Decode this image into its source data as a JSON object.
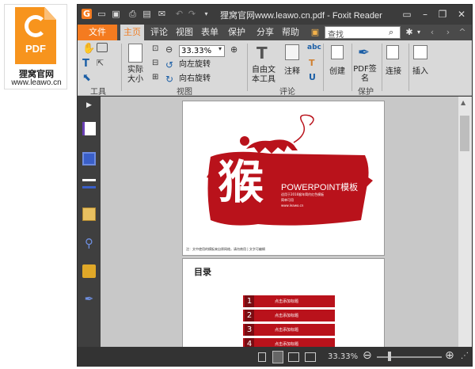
{
  "logo": {
    "badge": "PDF",
    "line1": "狸窝官网",
    "line2": "www.leawo.cn"
  },
  "window": {
    "title": "狸窝官网www.leawo.cn.pdf - Foxit Reader",
    "minimize": "–",
    "restore": "❐",
    "close": "✕"
  },
  "menus": [
    "文件",
    "主页",
    "评论",
    "视图",
    "表单",
    "保护",
    "分享",
    "帮助"
  ],
  "search": {
    "placeholder": "查找"
  },
  "ribbon": {
    "tools": {
      "group": "工具"
    },
    "view": {
      "group": "视图",
      "actual_size": "实际\n大小",
      "zoom": "33.33%",
      "rotate_left": "向左旋转",
      "rotate_right": "向右旋转"
    },
    "comment": {
      "group": "评论",
      "freetext": "自由文\n本工具",
      "note": "注释"
    },
    "protect": {
      "group": "保护",
      "create": "创建",
      "pdf_sign": "PDF签\n名",
      "link": "连接",
      "insert": "插入"
    }
  },
  "page1": {
    "big_char": "猴",
    "heading": "POWERPOINT模板",
    "line_a": "适用于2016猴年简约红色模板",
    "line_b": "简单可用",
    "line_c": "www.leawo.cn",
    "footer": "注：文中使用的模板来自原网络，请勿商用 | 文字可编辑"
  },
  "page2": {
    "heading": "目录",
    "items": [
      "1",
      "2",
      "3",
      "4"
    ],
    "item_text": "点击添加标题"
  },
  "status": {
    "zoom": "33.33%"
  }
}
